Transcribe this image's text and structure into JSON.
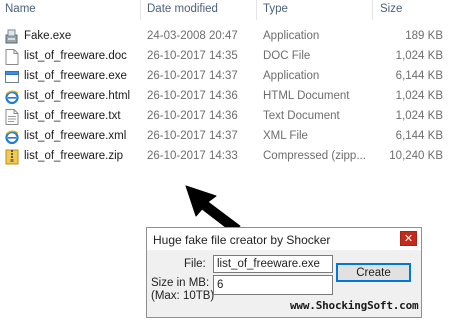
{
  "columns": {
    "name": "Name",
    "date": "Date modified",
    "type": "Type",
    "size": "Size"
  },
  "files": [
    {
      "name": "Fake.exe",
      "date": "24-03-2008 20:47",
      "type": "Application",
      "size": "189 KB",
      "icon": "setup-app-icon"
    },
    {
      "name": "list_of_freeware.doc",
      "date": "26-10-2017 14:35",
      "type": "DOC File",
      "size": "1,024 KB",
      "icon": "doc-file-icon"
    },
    {
      "name": "list_of_freeware.exe",
      "date": "26-10-2017 14:37",
      "type": "Application",
      "size": "6,144 KB",
      "icon": "exe-window-icon"
    },
    {
      "name": "list_of_freeware.html",
      "date": "26-10-2017 14:36",
      "type": "HTML Document",
      "size": "1,024 KB",
      "icon": "browser-icon"
    },
    {
      "name": "list_of_freeware.txt",
      "date": "26-10-2017 14:36",
      "type": "Text Document",
      "size": "1,024 KB",
      "icon": "text-file-icon"
    },
    {
      "name": "list_of_freeware.xml",
      "date": "26-10-2017 14:37",
      "type": "XML File",
      "size": "6,144 KB",
      "icon": "browser-icon"
    },
    {
      "name": "list_of_freeware.zip",
      "date": "26-10-2017 14:33",
      "type": "Compressed (zipp...",
      "size": "10,240 KB",
      "icon": "zip-folder-icon"
    }
  ],
  "dialog": {
    "title": "Huge fake file creator by Shocker",
    "close_label": "✕",
    "file_label": "File:",
    "file_value": "list_of_freeware.exe",
    "size_label_1": "Size in MB:",
    "size_label_2": "(Max: 10TB)",
    "size_value": "6",
    "create_label": "Create",
    "website": "www.ShockingSoft.com"
  },
  "colors": {
    "close": "#c42b1c",
    "focus": "#0078d7",
    "header_text": "#4c607a"
  }
}
